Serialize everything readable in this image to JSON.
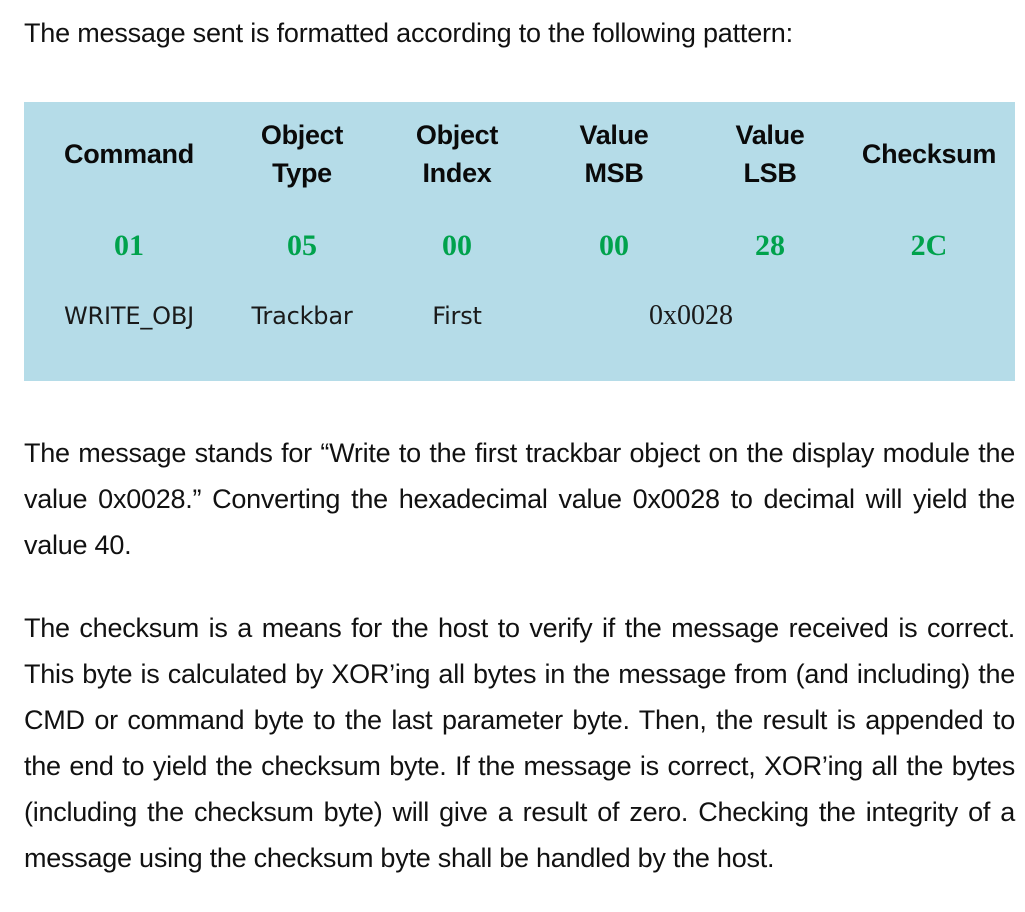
{
  "document": {
    "intro": "The message sent is formatted according to the following pattern:",
    "table": {
      "headers": [
        {
          "line1": "Command",
          "line2": ""
        },
        {
          "line1": "Object",
          "line2": "Type"
        },
        {
          "line1": "Object",
          "line2": "Index"
        },
        {
          "line1": "Value",
          "line2": "MSB"
        },
        {
          "line1": "Value",
          "line2": "LSB"
        },
        {
          "line1": "Checksum",
          "line2": ""
        }
      ],
      "hex_values": [
        "01",
        "05",
        "00",
        "00",
        "28",
        "2C"
      ],
      "descriptions": {
        "command": "WRITE_OBJ",
        "object_type": "Trackbar",
        "object_index": "First",
        "value": "0x0028"
      },
      "colors": {
        "background": "#b5dce8",
        "hex_text": "#00a24c",
        "header_text": "#0a0a0a",
        "description_text": "#1a1a1a"
      }
    },
    "paragraphs": {
      "p1": "The message stands for “Write to the first trackbar object on the display module the value 0x0028.” Converting the hexadecimal value 0x0028 to decimal will yield the value 40.",
      "p2": "The checksum is a means for the host to verify if the message received is correct. This byte is calculated by XOR’ing all bytes in the message from (and including) the CMD or command byte to the last parameter byte. Then, the result is appended to the end to yield the checksum byte. If the message is correct, XOR’ing all the bytes (including the checksum byte) will give a result of zero. Checking the integrity of a message using the checksum byte shall be handled by the host."
    }
  }
}
